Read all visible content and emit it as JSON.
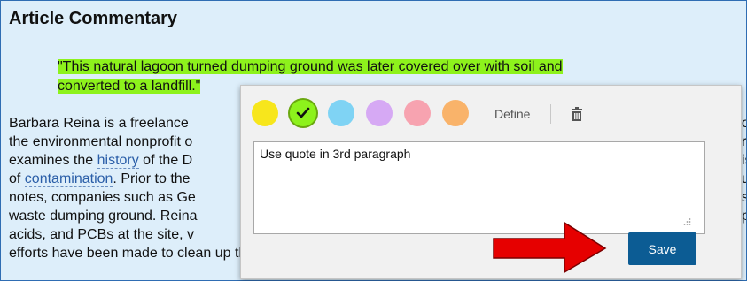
{
  "article": {
    "heading": "Article Commentary",
    "quote_line1": "\"This natural lagoon turned dumping ground was later covered over with soil and",
    "quote_line2": "converted to a landfill.\"",
    "lines": [
      "Barbara Reina is a freelance",
      "the environmental nonprofit o",
      [
        "examines the ",
        "history",
        " of the D"
      ],
      [
        "of ",
        "contamination",
        ". Prior to the"
      ],
      "notes, companies such as Ge",
      "waste dumping ground. Reina",
      "acids, and PCBs at the site, v",
      "efforts have been made to clean up the site, the critics accuse, the Renton Texaco facility"
    ],
    "right_edge_chars": [
      "o",
      "r",
      "is",
      "u",
      "s",
      "p",
      ""
    ]
  },
  "popup": {
    "colors": [
      {
        "name": "yellow",
        "hex": "#f7e61c",
        "selected": false
      },
      {
        "name": "green",
        "hex": "#8df21c",
        "selected": true
      },
      {
        "name": "blue",
        "hex": "#7fd3f4",
        "selected": false
      },
      {
        "name": "purple",
        "hex": "#d6a9f4",
        "selected": false
      },
      {
        "name": "pink",
        "hex": "#f7a3b0",
        "selected": false
      },
      {
        "name": "orange",
        "hex": "#f9b36a",
        "selected": false
      }
    ],
    "define_label": "Define",
    "note_value": "Use quote in 3rd paragraph",
    "save_label": "Save"
  },
  "annotation": {
    "arrow_color": "#e60000"
  }
}
